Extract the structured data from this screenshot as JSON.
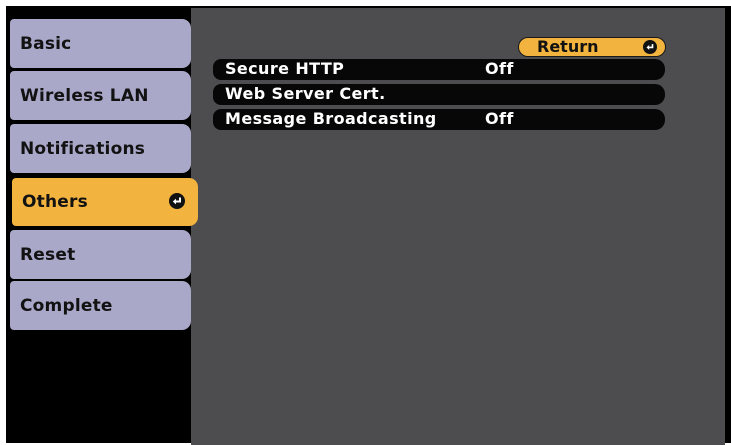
{
  "sidebar": {
    "items": [
      {
        "label": "Basic",
        "active": false
      },
      {
        "label": "Wireless LAN",
        "active": false
      },
      {
        "label": "Notifications",
        "active": false
      },
      {
        "label": "Others",
        "active": true
      },
      {
        "label": "Reset",
        "active": false
      },
      {
        "label": "Complete",
        "active": false
      }
    ]
  },
  "main": {
    "return_label": "Return",
    "rows": [
      {
        "label": "Secure HTTP",
        "value": "Off"
      },
      {
        "label": "Web Server Cert.",
        "value": ""
      },
      {
        "label": "Message Broadcasting",
        "value": "Off"
      }
    ]
  },
  "colors": {
    "background": "#000000",
    "panel": "#4d4d4f",
    "sidebar_item": "#a9a8c9",
    "accent": "#f3b43f",
    "row": "#070707",
    "text_light": "#ffffff",
    "text_dark": "#121212"
  },
  "icons": {
    "enter": "enter-return-icon"
  }
}
